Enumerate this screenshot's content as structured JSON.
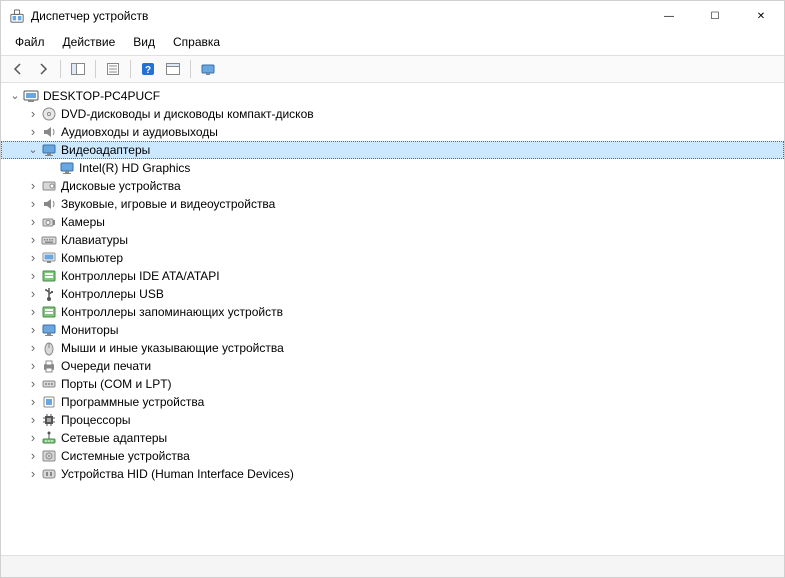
{
  "window": {
    "title": "Диспетчер устройств",
    "minimize": "—",
    "maximize": "☐",
    "close": "✕"
  },
  "menu": {
    "file": "Файл",
    "action": "Действие",
    "view": "Вид",
    "help": "Справка"
  },
  "toolbar": {
    "back": "←",
    "forward": "→"
  },
  "root": {
    "label": "DESKTOP-PC4PUCF"
  },
  "categories": [
    {
      "label": "DVD-дисководы и дисководы компакт-дисков",
      "icon": "disc",
      "expanded": false
    },
    {
      "label": "Аудиовходы и аудиовыходы",
      "icon": "speaker",
      "expanded": false
    },
    {
      "label": "Видеоадаптеры",
      "icon": "monitor",
      "expanded": true,
      "selected": true,
      "children": [
        {
          "label": "Intel(R) HD Graphics",
          "icon": "monitor"
        }
      ]
    },
    {
      "label": "Дисковые устройства",
      "icon": "drive",
      "expanded": false
    },
    {
      "label": "Звуковые, игровые и видеоустройства",
      "icon": "speaker",
      "expanded": false
    },
    {
      "label": "Камеры",
      "icon": "camera",
      "expanded": false
    },
    {
      "label": "Клавиатуры",
      "icon": "keyboard",
      "expanded": false
    },
    {
      "label": "Компьютер",
      "icon": "computer",
      "expanded": false
    },
    {
      "label": "Контроллеры IDE ATA/ATAPI",
      "icon": "storage",
      "expanded": false
    },
    {
      "label": "Контроллеры USB",
      "icon": "usb",
      "expanded": false
    },
    {
      "label": "Контроллеры запоминающих устройств",
      "icon": "storage",
      "expanded": false
    },
    {
      "label": "Мониторы",
      "icon": "monitor",
      "expanded": false
    },
    {
      "label": "Мыши и иные указывающие устройства",
      "icon": "mouse",
      "expanded": false
    },
    {
      "label": "Очереди печати",
      "icon": "printer",
      "expanded": false
    },
    {
      "label": "Порты (COM и LPT)",
      "icon": "port",
      "expanded": false
    },
    {
      "label": "Программные устройства",
      "icon": "software",
      "expanded": false
    },
    {
      "label": "Процессоры",
      "icon": "cpu",
      "expanded": false
    },
    {
      "label": "Сетевые адаптеры",
      "icon": "network",
      "expanded": false
    },
    {
      "label": "Системные устройства",
      "icon": "system",
      "expanded": false
    },
    {
      "label": "Устройства HID (Human Interface Devices)",
      "icon": "hid",
      "expanded": false
    }
  ]
}
